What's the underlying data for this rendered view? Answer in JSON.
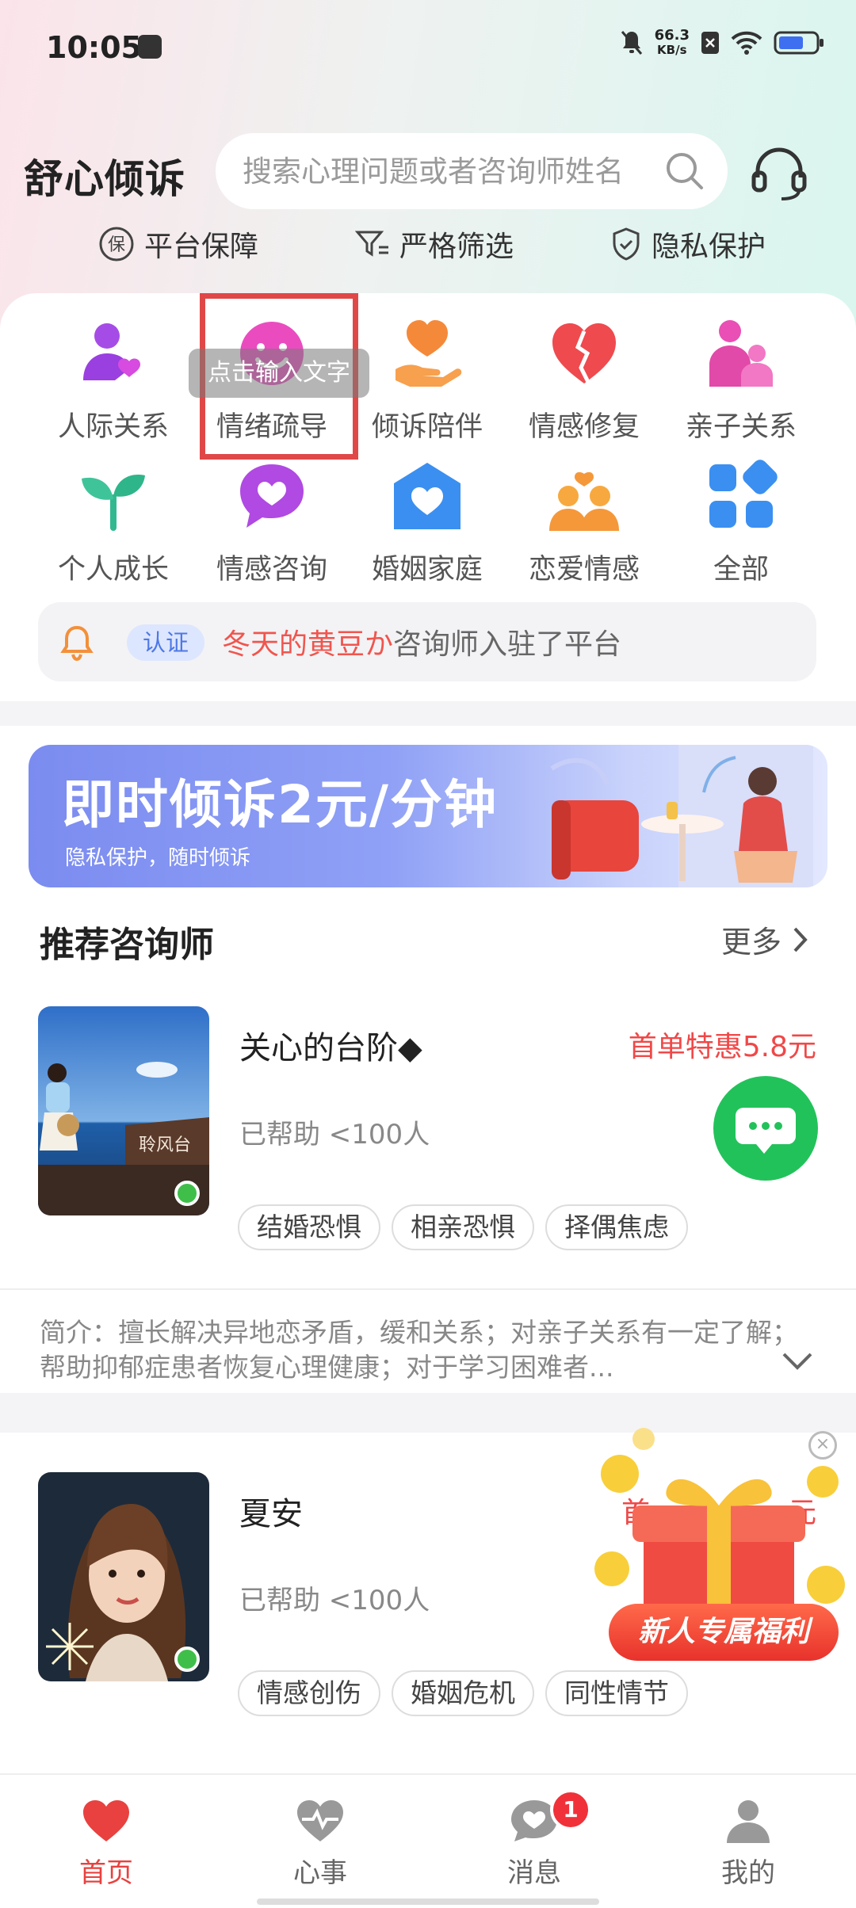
{
  "status": {
    "time": "10:05",
    "net_speed_value": "66.3",
    "net_speed_unit": "KB/s"
  },
  "header": {
    "app_title": "舒心倾诉",
    "search_placeholder": "搜索心理问题或者咨询师姓名"
  },
  "guarantees": [
    "平台保障",
    "严格筛选",
    "隐私保护"
  ],
  "categories": [
    {
      "label": "人际关系",
      "icon": "people-heart-icon"
    },
    {
      "label": "情绪疏导",
      "icon": "smile-face-icon"
    },
    {
      "label": "倾诉陪伴",
      "icon": "heart-hand-icon"
    },
    {
      "label": "情感修复",
      "icon": "broken-heart-icon"
    },
    {
      "label": "亲子关系",
      "icon": "parent-child-icon"
    },
    {
      "label": "个人成长",
      "icon": "sprout-icon"
    },
    {
      "label": "情感咨询",
      "icon": "heart-chat-icon"
    },
    {
      "label": "婚姻家庭",
      "icon": "heart-house-icon"
    },
    {
      "label": "恋爱情感",
      "icon": "couple-icon"
    },
    {
      "label": "全部",
      "icon": "grid-icon"
    }
  ],
  "tooltip": "点击输入文字",
  "notice": {
    "badge": "认证",
    "name": "冬天的黄豆か",
    "text": "咨询师入驻了平台"
  },
  "banner": {
    "title": "即时倾诉2元/分钟",
    "subtitle": "隐私保护，随时倾诉"
  },
  "recommend": {
    "title": "推荐咨询师",
    "more": "更多"
  },
  "counselors": [
    {
      "name": "关心的台阶◆",
      "promo": "首单特惠5.8元",
      "helped": "已帮助 <100人",
      "tags": [
        "结婚恐惧",
        "相亲恐惧",
        "择偶焦虑"
      ],
      "avatar_text": "聆风台",
      "online": true
    },
    {
      "name": "夏安",
      "promo": "首",
      "promo_tail": "元",
      "helped": "已帮助 <100人",
      "tags": [
        "情感创伤",
        "婚姻危机",
        "同性情节"
      ],
      "online": true
    }
  ],
  "intro": "简介：擅长解决异地恋矛盾，缓和关系；对亲子关系有一定了解；帮助抑郁症患者恢复心理健康；对于学习困难者...",
  "gift": {
    "label": "新人专属福利"
  },
  "tabs": [
    {
      "label": "首页",
      "icon": "heart-icon",
      "active": true
    },
    {
      "label": "心事",
      "icon": "heartbeat-icon",
      "active": false
    },
    {
      "label": "消息",
      "icon": "message-icon",
      "active": false,
      "badge": "1"
    },
    {
      "label": "我的",
      "icon": "person-icon",
      "active": false
    }
  ],
  "colors": {
    "accent": "#e8413f",
    "online": "#3fbf4a",
    "chat": "#22c25a",
    "cert": "#4e78e6"
  }
}
